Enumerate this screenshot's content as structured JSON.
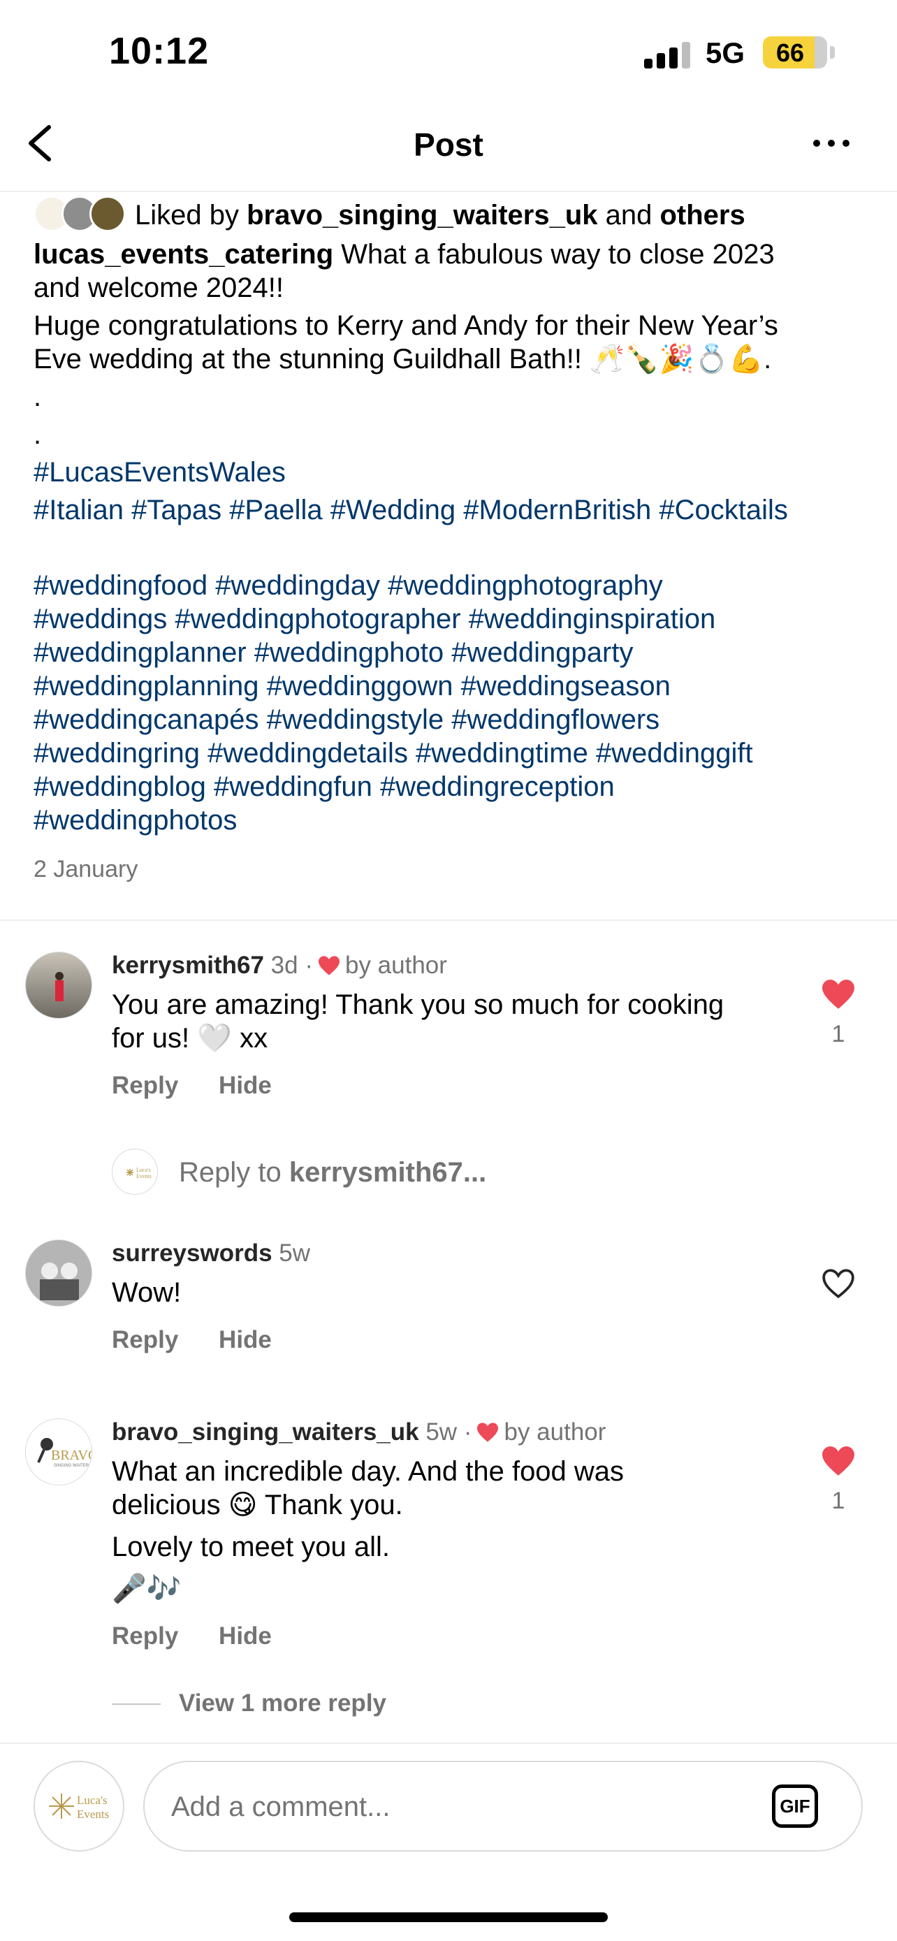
{
  "status_bar": {
    "time": "10:12",
    "network": "5G",
    "battery": "66",
    "battery_level_percent": 66
  },
  "header": {
    "title": "Post",
    "back_icon": "chevron-left-icon",
    "more_icon": "more-horizontal-icon"
  },
  "likes": {
    "prefix": "Liked by ",
    "user": "bravo_singing_waiters_uk",
    "middle": " and ",
    "suffix": "others"
  },
  "caption": {
    "author": "lucas_events_catering",
    "line1": " What a fabulous way to close 2023",
    "line2": "and welcome 2024!!",
    "line3": "Huge congratulations to Kerry and Andy for their New Year’s",
    "line4": "Eve wedding at the stunning Guildhall Bath!! 🥂🍾🎉💍💪.",
    "dot1": ".",
    "dot2": ".",
    "tags1": "#LucasEventsWales",
    "tags2": "#Italian #Tapas #Paella #Wedding #ModernBritish #Cocktails",
    "tags3": "#weddingfood #weddingday #weddingphotography",
    "tags4": "#weddings #weddingphotographer #weddinginspiration",
    "tags5": "#weddingplanner #weddingphoto #weddingparty",
    "tags6": "#weddingplanning #weddinggown #weddingseason",
    "tags7": "#weddingcanapés #weddingstyle #weddingflowers",
    "tags8": "#weddingring #weddingdetails #weddingtime #weddinggift",
    "tags9": "#weddingblog #weddingfun #weddingreception",
    "tags10": "#weddingphotos",
    "date": "2 January"
  },
  "comments": [
    {
      "user": "kerrysmith67",
      "age": "3d",
      "sep": "·",
      "author_like": "by author",
      "text1": "You are amazing! Thank you so much for cooking",
      "text2": "for us! 🤍 xx",
      "reply": "Reply",
      "hide": "Hide",
      "likes": "1"
    },
    {
      "user": "surreyswords",
      "age": "5w",
      "text1": "Wow!",
      "reply": "Reply",
      "hide": "Hide"
    },
    {
      "user": "bravo_singing_waiters_uk",
      "age": "5w",
      "sep": "·",
      "author_like": "by author",
      "text1": "What an incredible day. And the food was",
      "text2": "delicious 😋 Thank you.",
      "text3": "Lovely to meet you all.",
      "text4": "🎤🎶",
      "reply": "Reply",
      "hide": "Hide",
      "likes": "1"
    }
  ],
  "reply_to": {
    "prefix": "Reply to ",
    "user": "kerrysmith67..."
  },
  "view_more": "View 1 more reply",
  "comment_input": {
    "placeholder": "Add a comment...",
    "gif_label": "GIF"
  },
  "colors": {
    "heart": "#ed4956",
    "hashtag": "#00376b",
    "muted": "#737373",
    "battery": "#f6d23c"
  }
}
